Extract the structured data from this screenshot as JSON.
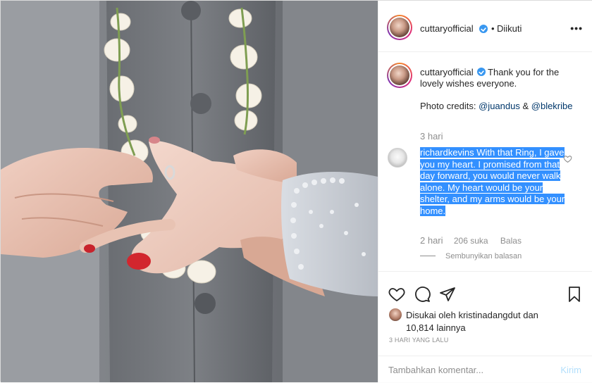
{
  "post": {
    "username": "cuttaryofficial",
    "separator": "•",
    "follow_status": "Diikuti",
    "more_icon": "more-options-icon",
    "caption": {
      "username": "cuttaryofficial",
      "line1": "Thank you for the lovely wishes everyone.",
      "credits_prefix": "Photo credits: ",
      "mention1": "@juandus",
      "amp": " & ",
      "mention2": "@blekribe",
      "time": "3 hari"
    },
    "reply": {
      "username": "richardkevins",
      "text": "With that Ring, I gave you my heart. I promised from that day forward, you would never walk alone. My heart would be your shelter, and my arms would be your home.",
      "time": "2 hari",
      "likes": "206 suka",
      "reply_label": "Balas",
      "hide_replies": "Sembunyikan balasan"
    },
    "liked_by_prefix": "Disukai oleh ",
    "liked_by_user": "kristinadangdut",
    "liked_by_and": " dan",
    "liked_by_count": "10,814 lainnya",
    "posted_ago": "3 HARI YANG LALU",
    "comment_placeholder": "Tambahkan komentar...",
    "post_button": "Kirim"
  },
  "colors": {
    "selection": "#3390ff",
    "verified": "#3897f0",
    "link": "#00376b",
    "muted": "#8e8e8e",
    "post_disabled": "#b2dffc"
  }
}
